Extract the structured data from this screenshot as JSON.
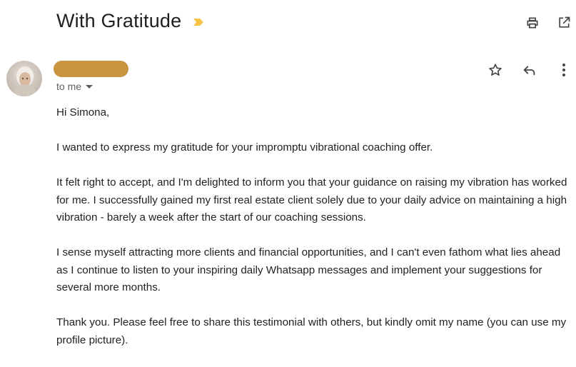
{
  "email": {
    "subject": "With Gratitude",
    "recipient_label": "to me",
    "colors": {
      "importance_marker": "#f6c344",
      "sender_redaction": "#c89440"
    },
    "icons": {
      "top": [
        "print-icon",
        "open-in-new-window-icon"
      ],
      "message": [
        "star-icon",
        "reply-icon",
        "more-options-icon"
      ]
    },
    "body_paragraphs": [
      "Hi Simona,",
      "I wanted to express my gratitude for your impromptu vibrational coaching offer.",
      "It felt right to accept, and I'm delighted to inform you that your guidance on raising my vibration has worked for me. I successfully gained my first real estate client solely due to your daily advice on maintaining a high vibration - barely a week after the start of our coaching sessions.",
      "I sense myself attracting more clients and financial opportunities, and I can't even fathom what lies ahead as I continue to listen to your inspiring daily Whatsapp messages and implement your suggestions for several more months.",
      "Thank you. Please feel free to share this testimonial with others, but kindly omit my name (you can use my profile picture)."
    ]
  }
}
